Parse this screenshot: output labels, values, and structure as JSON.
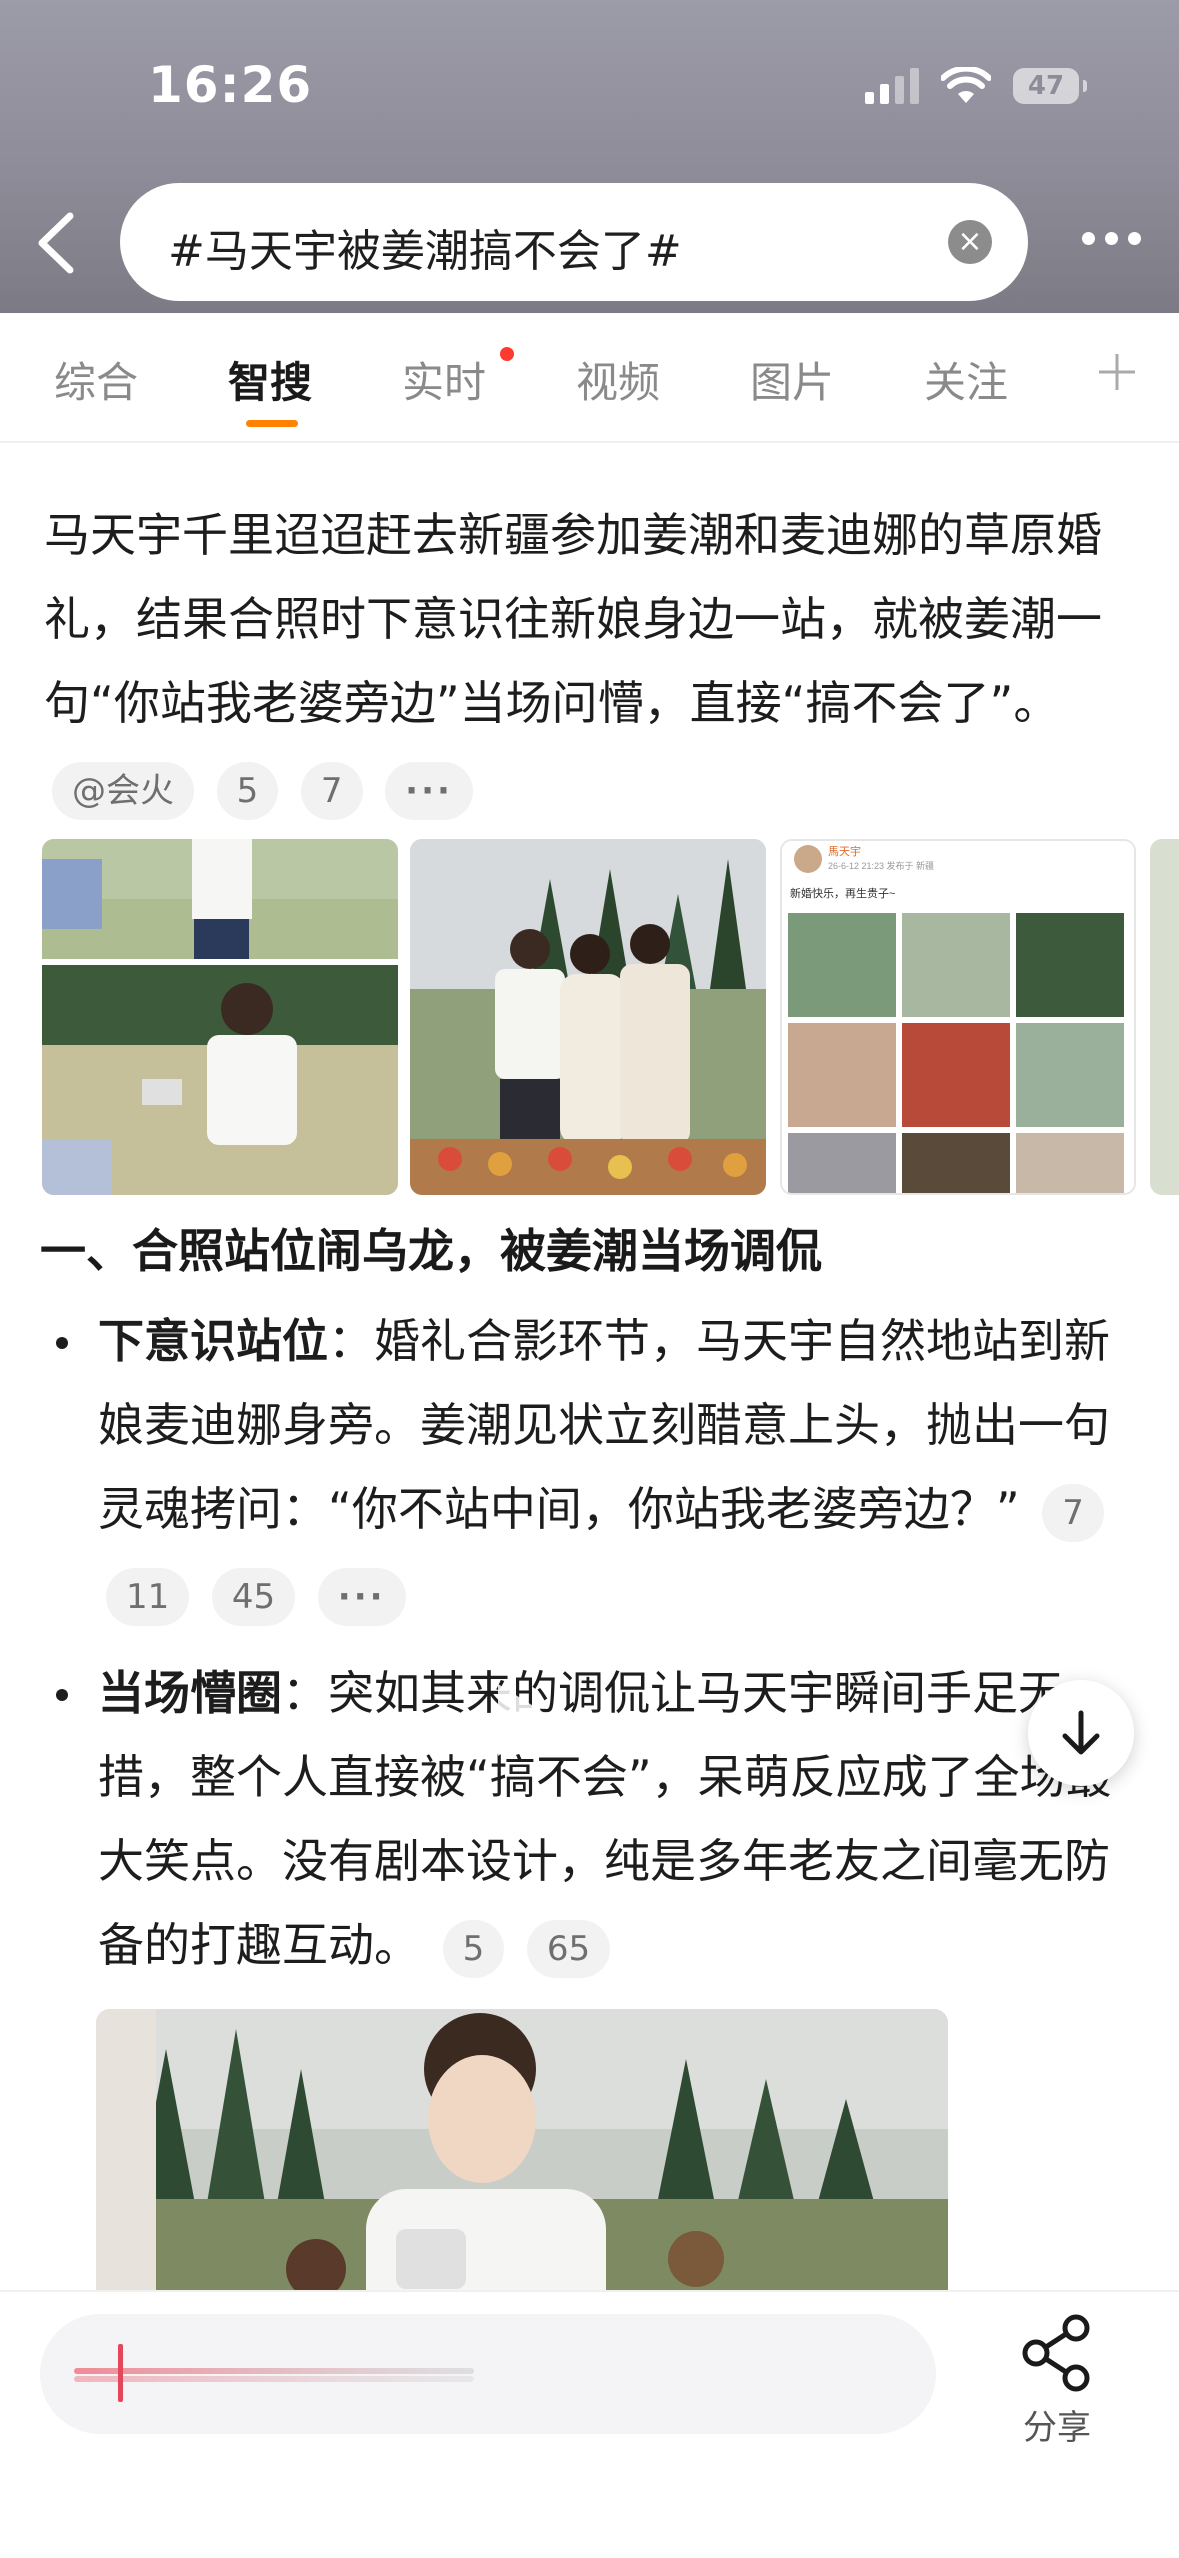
{
  "status_bar": {
    "time": "16:26",
    "battery": "47"
  },
  "search": {
    "query": "#马天宇被姜潮搞不会了#"
  },
  "tabs": [
    {
      "label": "综合"
    },
    {
      "label": "智搜"
    },
    {
      "label": "实时"
    },
    {
      "label": "视频"
    },
    {
      "label": "图片"
    },
    {
      "label": "关注"
    }
  ],
  "active_tab": "智搜",
  "intro": {
    "text": "马天宇千里迢迢赶去新疆参加姜潮和麦迪娜的草原婚礼，结果合照时下意识往新娘身边一站，就被姜潮一句“你站我老婆旁边”当场问懵，直接“搞不会了”。",
    "chips": [
      "@会火",
      "5",
      "7",
      "···"
    ]
  },
  "images": {
    "third_caption_user": "馬天宇",
    "third_caption_time": "26-6-12 21:23 发布于 新疆",
    "third_caption_text": "新婚快乐，再生贵子~"
  },
  "section1": {
    "title": "一、合照站位闹乌龙，被姜潮当场调侃",
    "bullets": [
      {
        "bold": "下意识站位",
        "text": "：婚礼合影环节，马天宇自然地站到新娘麦迪娜身旁。姜潮见状立刻醋意上头，抛出一句灵魂拷问：“你不站中间，你站我老婆旁边？”",
        "chips": [
          "7",
          "11",
          "45",
          "···"
        ]
      },
      {
        "bold": "当场懵圈",
        "text": "：突如其来的调侃让马天宇瞬间手足无措，整个人直接被“搞不会”，呆萌反应成了全场最大笑点。没有剧本设计，纯是多年老友之间毫无防备的打趣互动。",
        "chips": [
          "5",
          "65"
        ]
      }
    ]
  },
  "bottom": {
    "share_label": "分享"
  },
  "colors": {
    "accent": "#ff8200",
    "badge": "#ff3b30"
  }
}
